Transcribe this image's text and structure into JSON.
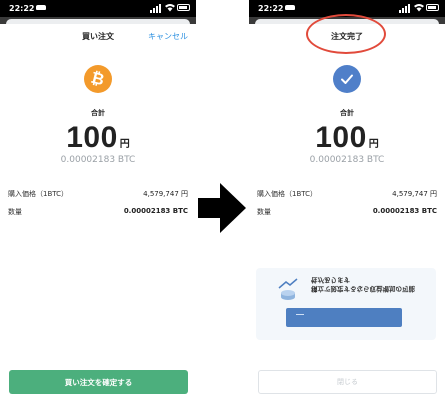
{
  "left": {
    "status_time": "22:22",
    "title": "買い注文",
    "cancel": "キャンセル",
    "coin_icon": "bitcoin-icon",
    "coin_symbol": "₿",
    "total_label": "合計",
    "amount": "100",
    "currency": "円",
    "btc_amount": "0.00002183 BTC",
    "rows": [
      {
        "label": "購入価格（1BTC）",
        "value": "4,579,747 円"
      },
      {
        "label": "数量",
        "value": "0.00002183 BTC"
      }
    ],
    "confirm_button": "買い注文を確定する"
  },
  "right": {
    "status_time": "22:22",
    "title": "注文完了",
    "check_icon": "checkmark-icon",
    "total_label": "合計",
    "amount": "100",
    "currency": "円",
    "btc_amount": "0.00002183 BTC",
    "rows": [
      {
        "label": "購入価格（1BTC）",
        "value": "4,579,747 円"
      },
      {
        "label": "数量",
        "value": "0.00002183 BTC"
      }
    ],
    "promo_text": "積立で設定するなら収益増加の可能性があります",
    "close_button": "閉じる"
  },
  "colors": {
    "accent_blue": "#2a8fe0",
    "bitcoin_orange": "#f39a2b",
    "success_blue": "#4f7fc9",
    "confirm_green": "#4caf7d",
    "highlight_red": "#e14a3b"
  }
}
